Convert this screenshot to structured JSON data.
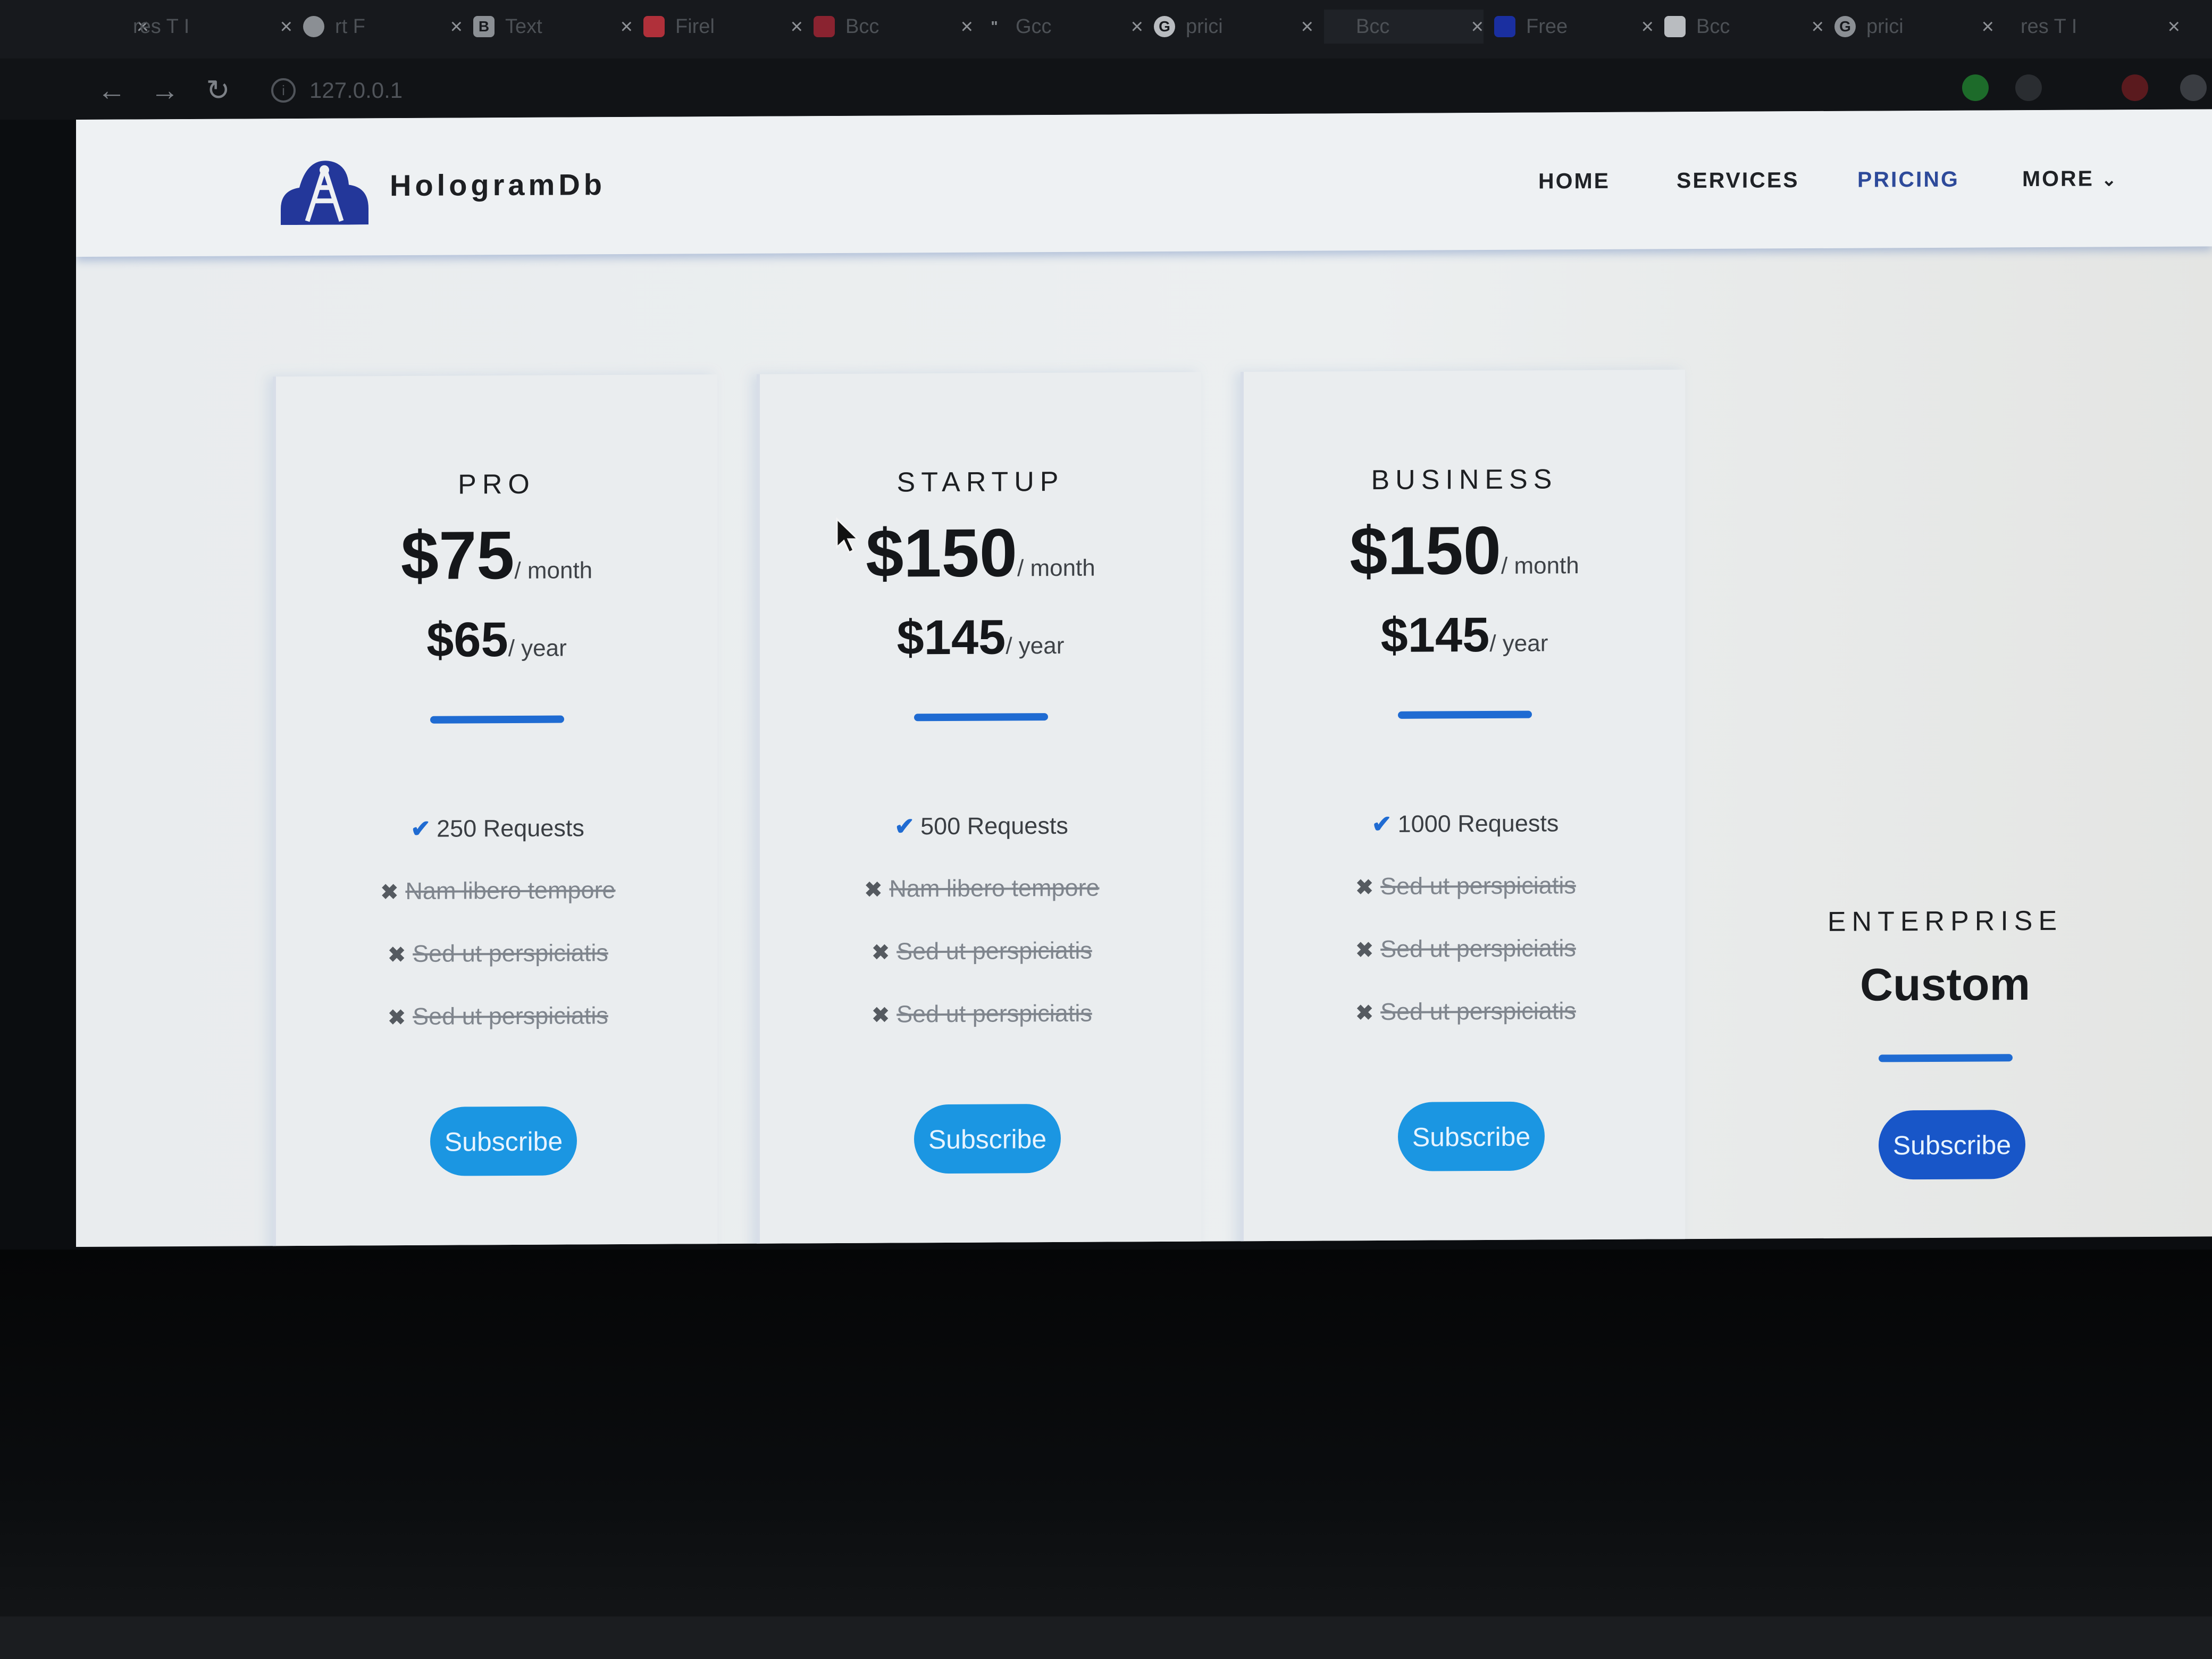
{
  "browser": {
    "tabs": [
      {
        "title": "",
        "icon": "blank-icon"
      },
      {
        "title": "res T I",
        "icon": "blank-icon"
      },
      {
        "title": "rt F",
        "icon": "globe-icon"
      },
      {
        "title": "Text",
        "icon": "bootstrap-icon"
      },
      {
        "title": "Firel",
        "icon": "firebase-icon"
      },
      {
        "title": "Bcc",
        "icon": "scroll-icon"
      },
      {
        "title": "Gcc",
        "icon": "quote-icon"
      },
      {
        "title": "prici",
        "icon": "google-icon"
      },
      {
        "title": "Bcc",
        "icon": "blank-icon"
      },
      {
        "title": "Free",
        "icon": "flag-icon"
      },
      {
        "title": "Bcc",
        "icon": "compass-icon"
      },
      {
        "title": "prici",
        "icon": "google-icon"
      },
      {
        "title": "res T I",
        "icon": "blank-icon"
      }
    ],
    "url": "127.0.0.1"
  },
  "site": {
    "brand": "HologramDb",
    "nav": {
      "home": "HOME",
      "services": "SERVICES",
      "pricing": "PRICING",
      "more": "MORE"
    }
  },
  "pricing": {
    "subscribe_label": "Subscribe",
    "plans": [
      {
        "name": "PRO",
        "monthly": "$75",
        "monthly_unit": "/ month",
        "yearly": "$65",
        "yearly_unit": "/ year",
        "features": [
          {
            "text": "250 Requests",
            "included": true
          },
          {
            "text": "Nam libero tempore",
            "included": false
          },
          {
            "text": "Sed ut perspiciatis",
            "included": false
          },
          {
            "text": "Sed ut perspiciatis",
            "included": false
          }
        ]
      },
      {
        "name": "STARTUP",
        "monthly": "$150",
        "monthly_unit": "/ month",
        "yearly": "$145",
        "yearly_unit": "/ year",
        "features": [
          {
            "text": "500 Requests",
            "included": true
          },
          {
            "text": "Nam libero tempore",
            "included": false
          },
          {
            "text": "Sed ut perspiciatis",
            "included": false
          },
          {
            "text": "Sed ut perspiciatis",
            "included": false
          }
        ]
      },
      {
        "name": "BUSINESS",
        "monthly": "$150",
        "monthly_unit": "/ month",
        "yearly": "$145",
        "yearly_unit": "/ year",
        "features": [
          {
            "text": "1000 Requests",
            "included": true
          },
          {
            "text": "Sed ut perspiciatis",
            "included": false
          },
          {
            "text": "Sed ut perspiciatis",
            "included": false
          },
          {
            "text": "Sed ut perspiciatis",
            "included": false
          }
        ]
      },
      {
        "name": "ENTERPRISE",
        "price": "Custom"
      }
    ]
  },
  "colors": {
    "accent": "#1f6bd2",
    "button": "#1b96e2",
    "button_dark": "#1856c8",
    "brand_logo": "#23379a"
  }
}
